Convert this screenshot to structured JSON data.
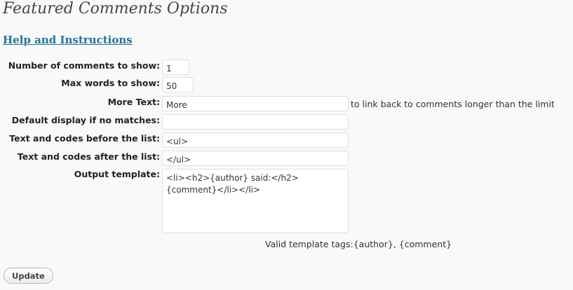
{
  "page_title": "Featured Comments Options",
  "help_link": "Help and Instructions",
  "fields": {
    "num_comments": {
      "label": "Number of comments to show:",
      "value": "1"
    },
    "max_words": {
      "label": "Max words to show:",
      "value": "50"
    },
    "more_text": {
      "label": "More Text:",
      "value": "More",
      "hint": "to link back to comments longer than the limit"
    },
    "default_display": {
      "label": "Default display if no matches:",
      "value": ""
    },
    "before_list": {
      "label": "Text and codes before the list:",
      "value": "<ul>"
    },
    "after_list": {
      "label": "Text and codes after the list:",
      "value": "</ul>"
    },
    "output_template": {
      "label": "Output template:",
      "value": "<li><h2>{author} said:</h2>\n{comment}</li></li>",
      "hint": "Valid template tags:{author}, {comment}"
    }
  },
  "update_button": "Update"
}
